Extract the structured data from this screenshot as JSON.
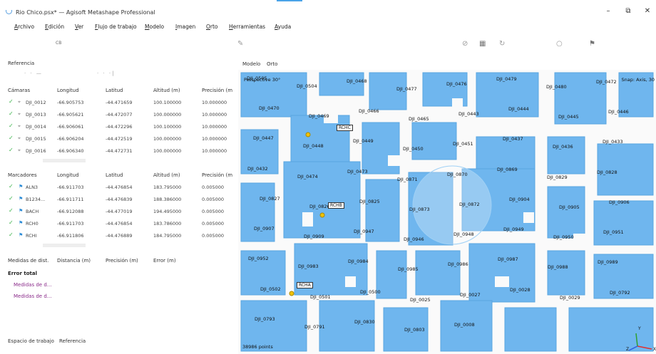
{
  "window": {
    "title": "Rio Chico.psx* — Agisoft Metashape Professional",
    "controls": [
      "–",
      "⧉",
      "✕"
    ]
  },
  "menu": [
    "Archivo",
    "Edición",
    "Ver",
    "Flujo de trabajo",
    "Modelo",
    "Imagen",
    "Orto",
    "Herramientas",
    "Ayuda"
  ],
  "toolbar": {
    "small_label": "CB"
  },
  "reference": {
    "title": "Referencia",
    "cameras": {
      "headers": [
        "Cámaras",
        "Longitud",
        "Latitud",
        "Altitud (m)",
        "Precisión (m"
      ],
      "rows": [
        {
          "name": "DJI_0012",
          "lon": "-66.905753",
          "lat": "-44.471659",
          "alt": "100.100000",
          "acc": "10.000000"
        },
        {
          "name": "DJI_0013",
          "lon": "-66.905621",
          "lat": "-44.472077",
          "alt": "100.000000",
          "acc": "10.000000"
        },
        {
          "name": "DJI_0014",
          "lon": "-66.906061",
          "lat": "-44.472296",
          "alt": "100.100000",
          "acc": "10.000000"
        },
        {
          "name": "DJI_0015",
          "lon": "-66.906204",
          "lat": "-44.472519",
          "alt": "100.000000",
          "acc": "10.000000"
        },
        {
          "name": "DJI_0016",
          "lon": "-66.906340",
          "lat": "-44.472731",
          "alt": "100.000000",
          "acc": "10.000000"
        }
      ]
    },
    "markers": {
      "headers": [
        "Marcadores",
        "Longitud",
        "Latitud",
        "Altitud (m)",
        "Precisión (m"
      ],
      "rows": [
        {
          "name": "ALN3",
          "lon": "-66.911703",
          "lat": "-44.476854",
          "alt": "183.795000",
          "acc": "0.005000"
        },
        {
          "name": "B1234...",
          "lon": "-66.911711",
          "lat": "-44.476839",
          "alt": "188.386000",
          "acc": "0.005000"
        },
        {
          "name": "BACH",
          "lon": "-66.912088",
          "lat": "-44.477019",
          "alt": "194.495000",
          "acc": "0.005000"
        },
        {
          "name": "RCH0",
          "lon": "-66.911703",
          "lat": "-44.476854",
          "alt": "183.786000",
          "acc": "0.005000"
        },
        {
          "name": "RCHI",
          "lon": "-66.911806",
          "lat": "-44.476889",
          "alt": "184.795000",
          "acc": "0.005000"
        }
      ]
    },
    "measures": {
      "headers": [
        "Medidas de dist.",
        "Distancia (m)",
        "Precisión (m)",
        "Error (m)"
      ],
      "total_error_label": "Error total",
      "items": [
        "Medidas de d...",
        "Medidas de d..."
      ]
    }
  },
  "bottom_tabs": [
    "Espacio de trabajo",
    "Referencia"
  ],
  "viewport": {
    "tabs": [
      "Modelo",
      "Orto"
    ],
    "perspective": "Perspective 30°",
    "snap": "Snap: Axis, 30",
    "points": "38986 points",
    "markers": [
      "RCHC",
      "RCHB",
      "RCHA"
    ],
    "axis_labels": [
      "Y",
      "Z",
      "X"
    ],
    "camera_labels": [
      "DJI_0505",
      "DJI_0504",
      "DJI_0468",
      "DJI_0477",
      "DJI_0476",
      "DJI_0479",
      "DJI_0480",
      "DJI_0472",
      "DJI_0470",
      "DJI_0469",
      "DJI_0466",
      "DJI_0465",
      "DJI_0443",
      "DJI_0444",
      "DJI_0445",
      "DJI_0446",
      "DJI_0447",
      "DJI_0448",
      "DJI_0449",
      "DJI_0450",
      "DJI_0451",
      "DJI_0437",
      "DJI_0436",
      "DJI_0433",
      "DJI_0432",
      "DJI_0474",
      "DJI_0473",
      "DJI_0871",
      "DJI_0870",
      "DJI_0869",
      "DJI_0829",
      "DJI_0828",
      "DJI_0827",
      "DJI_0826",
      "DJI_0825",
      "DJI_0873",
      "DJI_0872",
      "DJI_0904",
      "DJI_0905",
      "DJI_0906",
      "DJI_0907",
      "DJI_0909",
      "DJI_0947",
      "DJI_0946",
      "DJI_0948",
      "DJI_0949",
      "DJI_0950",
      "DJI_0951",
      "DJI_0952",
      "DJI_0983",
      "DJI_0984",
      "DJI_0985",
      "DJI_0986",
      "DJI_0987",
      "DJI_0988",
      "DJI_0989",
      "DJI_0502",
      "DJI_0501",
      "DJI_0500",
      "DJI_0025",
      "DJI_0027",
      "DJI_0028",
      "DJI_0029",
      "DJI_0792",
      "DJI_0793",
      "DJI_0791",
      "DJI_0830",
      "DJI_0803",
      "DJI_0008"
    ]
  },
  "colors": {
    "building": "#6fb6ee",
    "building_stroke": "#5aa5e0",
    "marker": "#f2c200",
    "check": "#3bb24a",
    "flag": "#2b8bd6",
    "purple_link": "#8a2a8a"
  }
}
